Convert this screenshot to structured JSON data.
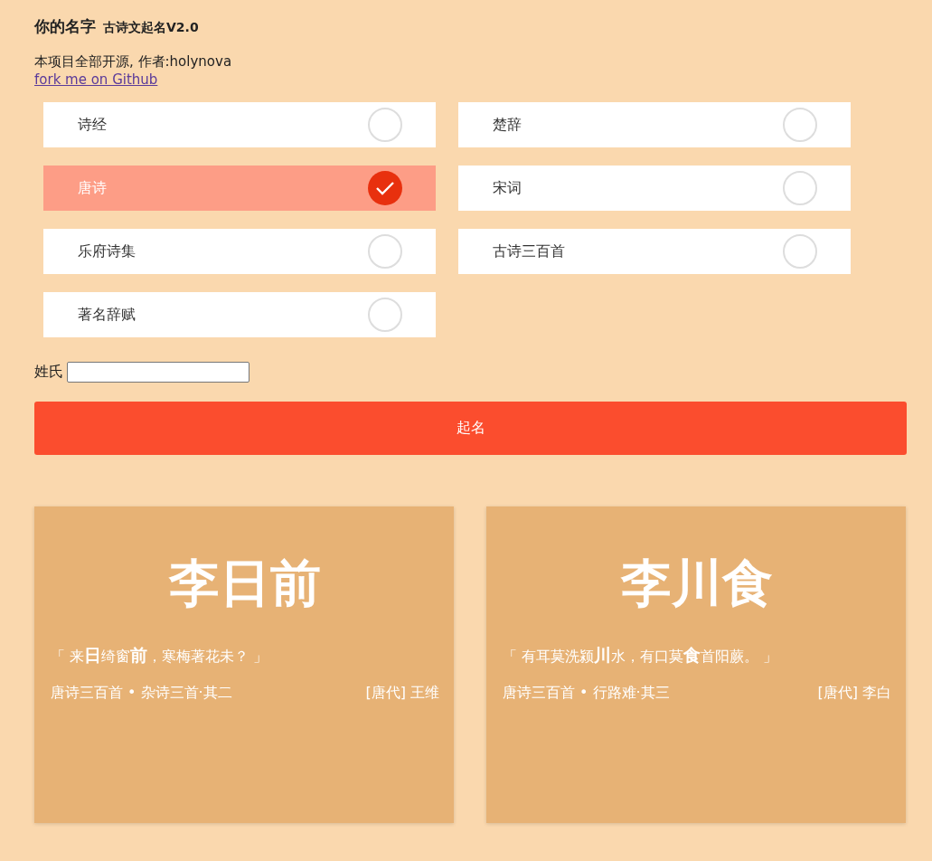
{
  "header": {
    "title": "你的名字",
    "subtitle": "古诗文起名V2.0"
  },
  "intro": "本项目全部开源, 作者:holynova",
  "link": "fork me on Github",
  "sources": [
    {
      "label": "诗经",
      "selected": false
    },
    {
      "label": "楚辞",
      "selected": false
    },
    {
      "label": "唐诗",
      "selected": true
    },
    {
      "label": "宋词",
      "selected": false
    },
    {
      "label": "乐府诗集",
      "selected": false
    },
    {
      "label": "古诗三百首",
      "selected": false
    },
    {
      "label": "著名辞赋",
      "selected": false
    }
  ],
  "surname": {
    "label": "姓氏"
  },
  "submit": "起名",
  "results": [
    {
      "name": "李日前",
      "quote": "「 来**日**绮窗**前**，寒梅著花未？ 」",
      "source": "唐诗三百首 • 杂诗三首·其二",
      "author": "[唐代] 王维"
    },
    {
      "name": "李川食",
      "quote": "「 有耳莫洗颍**川**水，有口莫**食**首阳蕨。 」",
      "source": "唐诗三百首 • 行路难·其三",
      "author": "[唐代] 李白"
    }
  ]
}
